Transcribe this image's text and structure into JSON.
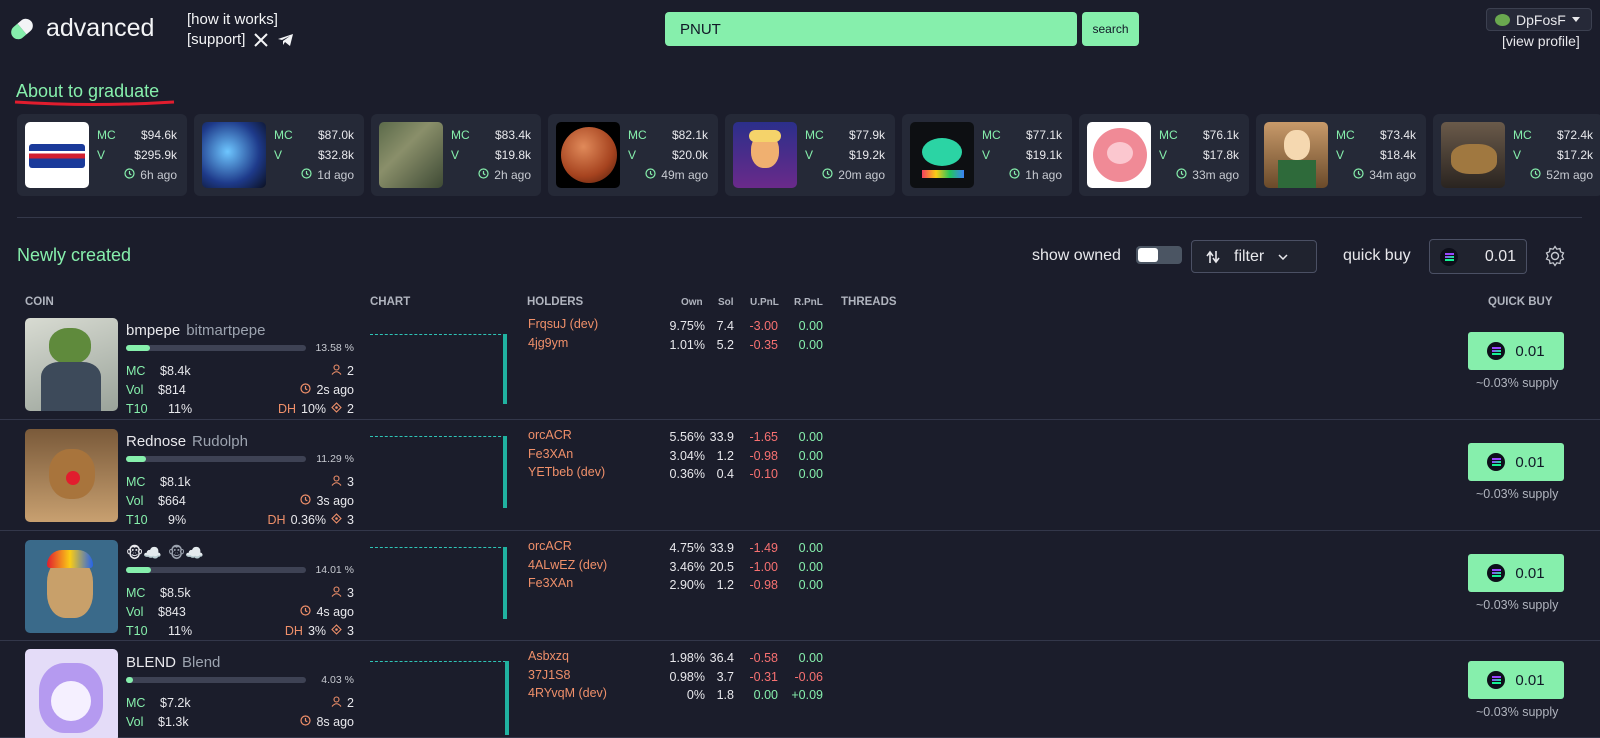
{
  "header": {
    "brand": "advanced",
    "how_it_works": "[how it works]",
    "support": "[support]",
    "search_value": "PNUT",
    "search_button": "search",
    "username": "DpFosF",
    "view_profile": "[view profile]"
  },
  "graduate": {
    "title": "About to graduate",
    "cards": [
      {
        "mc": "$94.6k",
        "v": "$295.9k",
        "time": "6h ago",
        "img": "pepsi"
      },
      {
        "mc": "$87.0k",
        "v": "$32.8k",
        "time": "1d ago",
        "img": "dna"
      },
      {
        "mc": "$83.4k",
        "v": "$19.8k",
        "time": "2h ago",
        "img": "forest"
      },
      {
        "mc": "$82.1k",
        "v": "$20.0k",
        "time": "49m ago",
        "img": "mars"
      },
      {
        "mc": "$77.9k",
        "v": "$19.2k",
        "time": "20m ago",
        "img": "trump"
      },
      {
        "mc": "$77.1k",
        "v": "$19.1k",
        "time": "1h ago",
        "img": "whale"
      },
      {
        "mc": "$76.1k",
        "v": "$17.8k",
        "time": "33m ago",
        "img": "pig"
      },
      {
        "mc": "$73.4k",
        "v": "$18.4k",
        "time": "34m ago",
        "img": "barista"
      },
      {
        "mc": "$72.4k",
        "v": "$17.2k",
        "time": "52m ago",
        "img": "bull"
      }
    ],
    "mc_label": "MC",
    "v_label": "V"
  },
  "newly": {
    "title": "Newly created",
    "show_owned": "show owned",
    "filter": "filter",
    "quick_buy": "quick buy",
    "quick_buy_amount": "0.01"
  },
  "columns": {
    "coin": "COIN",
    "chart": "CHART",
    "holders": "HOLDERS",
    "own": "Own",
    "sol": "Sol",
    "upnl": "U.PnL",
    "rpnl": "R.PnL",
    "threads": "THREADS",
    "quick_buy": "QUICK BUY"
  },
  "labels": {
    "mc": "MC",
    "vol": "Vol",
    "t10": "T10",
    "dh": "DH",
    "supply": "~0.03% supply"
  },
  "colors": {
    "accent": "#86efac",
    "background": "#1b1d2b",
    "negative": "#f87171",
    "holder": "#f0906a",
    "chart": "#20b2a0"
  },
  "coins": [
    {
      "name": "bmpepe",
      "ticker": "bitmartpepe",
      "progress": 13.58,
      "pct": "13.58 %",
      "mc": "$8.4k",
      "vol": "$814",
      "t10": "11%",
      "holders_count": "2",
      "age": "2s ago",
      "dh": "10%",
      "dh_count": "2",
      "buy": "0.01",
      "holders": [
        {
          "name": "FrqsuJ (dev)",
          "own": "9.75%",
          "sol": "7.4",
          "upnl": "-3.00",
          "rpnl": "0.00"
        },
        {
          "name": "4jg9ym",
          "own": "1.01%",
          "sol": "5.2",
          "upnl": "-0.35",
          "rpnl": "0.00"
        }
      ]
    },
    {
      "name": "Rednose",
      "ticker": "Rudolph",
      "progress": 11.29,
      "pct": "11.29 %",
      "mc": "$8.1k",
      "vol": "$664",
      "t10": "9%",
      "holders_count": "3",
      "age": "3s ago",
      "dh": "0.36%",
      "dh_count": "3",
      "buy": "0.01",
      "holders": [
        {
          "name": "orcACR",
          "own": "5.56%",
          "sol": "33.9",
          "upnl": "-1.65",
          "rpnl": "0.00"
        },
        {
          "name": "Fe3XAn",
          "own": "3.04%",
          "sol": "1.2",
          "upnl": "-0.98",
          "rpnl": "0.00"
        },
        {
          "name": "YETbeb (dev)",
          "own": "0.36%",
          "sol": "0.4",
          "upnl": "-0.10",
          "rpnl": "0.00"
        }
      ]
    },
    {
      "name": "🐵☁️",
      "ticker": "🐵☁️",
      "progress": 14.01,
      "pct": "14.01 %",
      "mc": "$8.5k",
      "vol": "$843",
      "t10": "11%",
      "holders_count": "3",
      "age": "4s ago",
      "dh": "3%",
      "dh_count": "3",
      "buy": "0.01",
      "holders": [
        {
          "name": "orcACR",
          "own": "4.75%",
          "sol": "33.9",
          "upnl": "-1.49",
          "rpnl": "0.00"
        },
        {
          "name": "4ALwEZ (dev)",
          "own": "3.46%",
          "sol": "20.5",
          "upnl": "-1.00",
          "rpnl": "0.00"
        },
        {
          "name": "Fe3XAn",
          "own": "2.90%",
          "sol": "1.2",
          "upnl": "-0.98",
          "rpnl": "0.00"
        }
      ]
    },
    {
      "name": "BLEND",
      "ticker": "Blend",
      "progress": 4.03,
      "pct": "4.03 %",
      "mc": "$7.2k",
      "vol": "$1.3k",
      "t10": "",
      "holders_count": "2",
      "age": "8s ago",
      "dh": "",
      "dh_count": "",
      "buy": "0.01",
      "holders": [
        {
          "name": "Asbxzq",
          "own": "1.98%",
          "sol": "36.4",
          "upnl": "-0.58",
          "rpnl": "0.00"
        },
        {
          "name": "37J1S8",
          "own": "0.98%",
          "sol": "3.7",
          "upnl": "-0.31",
          "rpnl": "-0.06"
        },
        {
          "name": "4RYvqM (dev)",
          "own": "0%",
          "sol": "1.8",
          "upnl": "0.00",
          "rpnl": "+0.09"
        }
      ]
    }
  ]
}
